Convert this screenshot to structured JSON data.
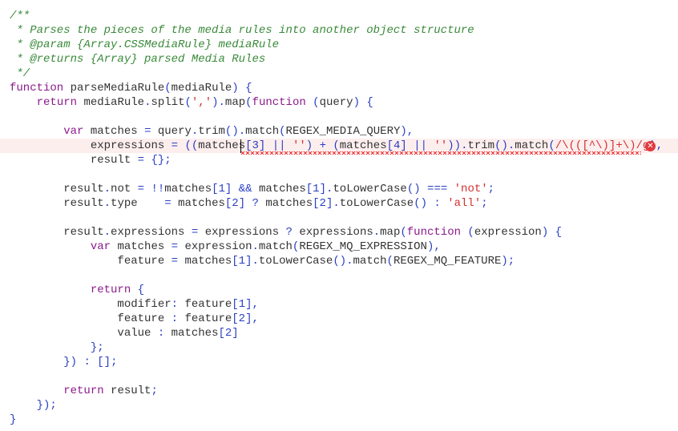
{
  "editor": {
    "lines": [
      "/**",
      " * Parses the pieces of the media rules into another object structure",
      " * @param {Array.CSSMediaRule} mediaRule",
      " * @returns {Array} parsed Media Rules",
      " */",
      "function parseMediaRule(mediaRule) {",
      "    return mediaRule.split(',').map(function (query) {",
      "",
      "        var matches = query.trim().match(REGEX_MEDIA_QUERY),",
      "            expressions = ((matches[3] || '') + (matches[4] || '')).trim().match(/\\(([^\\)]+\\)/g),",
      "            result = {};",
      "",
      "        result.not = !!matches[1] && matches[1].toLowerCase() === 'not';",
      "        result.type    = matches[2] ? matches[2].toLowerCase() : 'all';",
      "",
      "        result.expressions = expressions ? expressions.map(function (expression) {",
      "            var matches = expression.match(REGEX_MQ_EXPRESSION),",
      "                feature = matches[1].toLowerCase().match(REGEX_MQ_FEATURE);",
      "",
      "            return {",
      "                modifier: feature[1],",
      "                feature : feature[2],",
      "                value : matches[2]",
      "            };",
      "        }) : [];",
      "",
      "        return result;",
      "    });",
      "}"
    ],
    "error_line": 9,
    "error_icon": "error-circle-x-icon",
    "colors": {
      "comment": "#3a8a3a",
      "keyword": "#8b1a8b",
      "string": "#d0312d",
      "punctuation": "#2a3fc4",
      "error": "#e0393e",
      "error_line_bg": "#fdeeee"
    }
  }
}
